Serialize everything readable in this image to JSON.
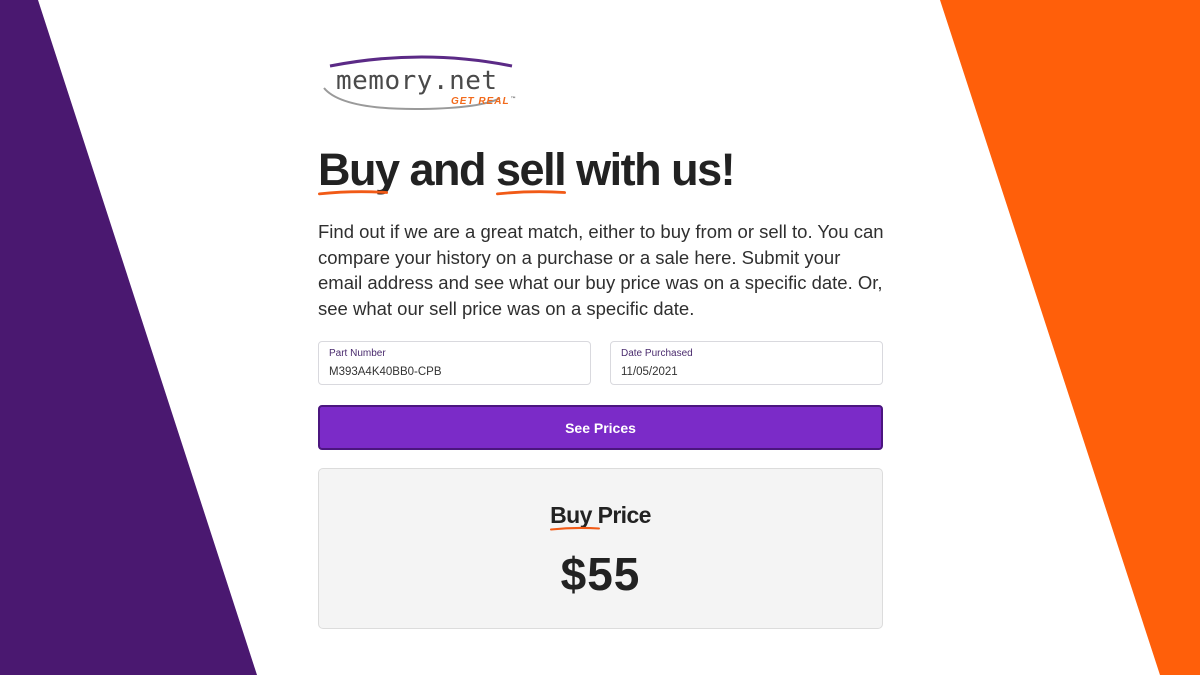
{
  "theme": {
    "purple": "#4a1870",
    "orange": "#ff5f0a",
    "button_purple": "#7b2bc8",
    "underline_orange": "#f15a16"
  },
  "logo": {
    "wordmark": "memory.net",
    "tagline": "GET REAL",
    "trademark": "™"
  },
  "headline": {
    "word1": "Buy",
    "middle": " and ",
    "word2": "sell",
    "rest": " with us!"
  },
  "intro": "Find out if we are a great match, either to buy from or sell to. You can compare your history on a purchase or a sale here. Submit your email address and see what our buy price was on a specific date. Or, see what our sell price was on a specific date.",
  "form": {
    "part_number": {
      "label": "Part Number",
      "value": "M393A4K40BB0-CPB"
    },
    "date_purchased": {
      "label": "Date Purchased",
      "value": "11/05/2021"
    },
    "submit_label": "See Prices"
  },
  "result": {
    "title_word1": "Buy",
    "title_rest": " Price",
    "value": "$55"
  }
}
